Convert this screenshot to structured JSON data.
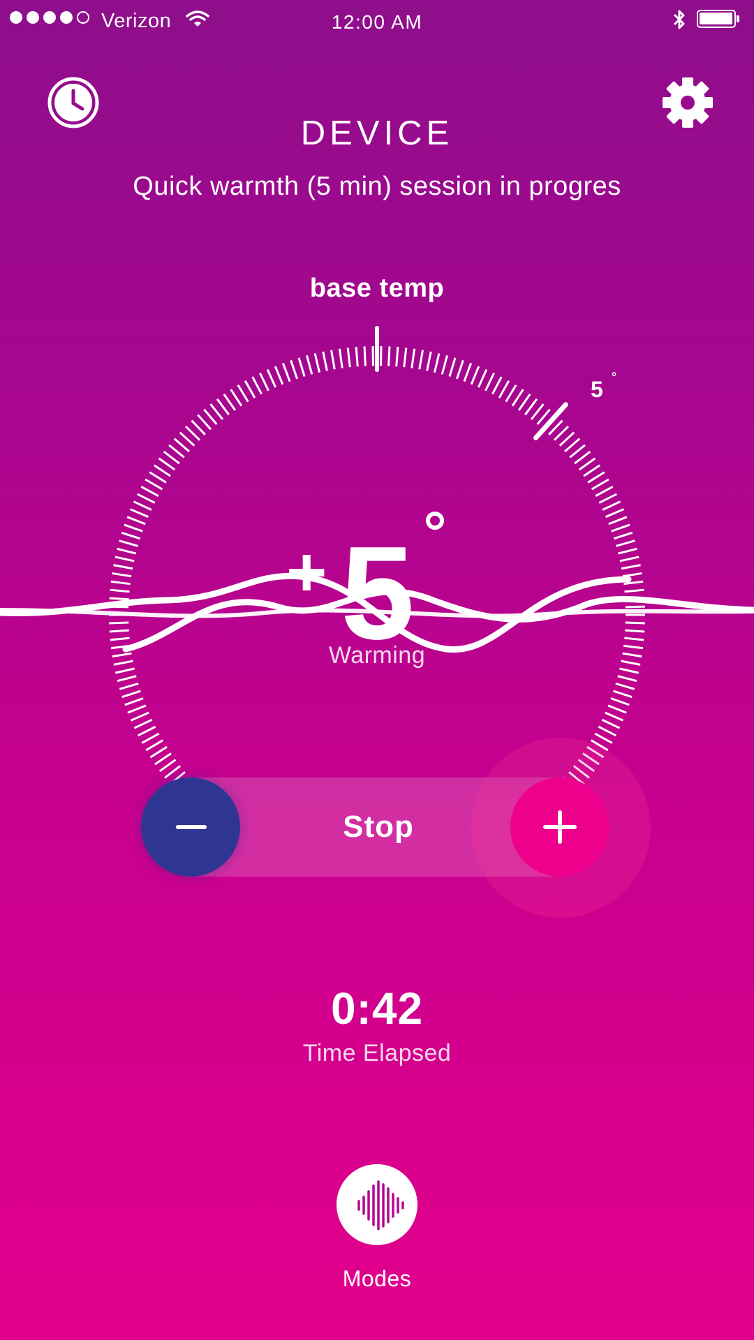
{
  "status_bar": {
    "carrier": "Verizon",
    "time": "12:00 AM",
    "signal_bars_filled": 4,
    "signal_bars_total": 5,
    "battery_level": 1.0
  },
  "header": {
    "title": "DEVICE",
    "left_icon": "clock-icon",
    "right_icon": "gear-icon"
  },
  "session": {
    "status_text": "Quick warmth (5 min) session in progres"
  },
  "dial": {
    "base_label": "base temp",
    "marker_label": "5",
    "marker_degree": "°",
    "sign": "+",
    "value": "5",
    "state": "Warming"
  },
  "controls": {
    "stop_label": "Stop",
    "minus_icon": "minus-icon",
    "plus_icon": "plus-icon"
  },
  "timer": {
    "elapsed": "0:42",
    "label": "Time Elapsed"
  },
  "modes": {
    "label": "Modes",
    "icon": "waveform-icon"
  },
  "colors": {
    "minus_button": "#2F3592",
    "plus_button": "#EC008C",
    "gradient_top": "#8E0E8C",
    "gradient_bottom": "#E2008C"
  }
}
